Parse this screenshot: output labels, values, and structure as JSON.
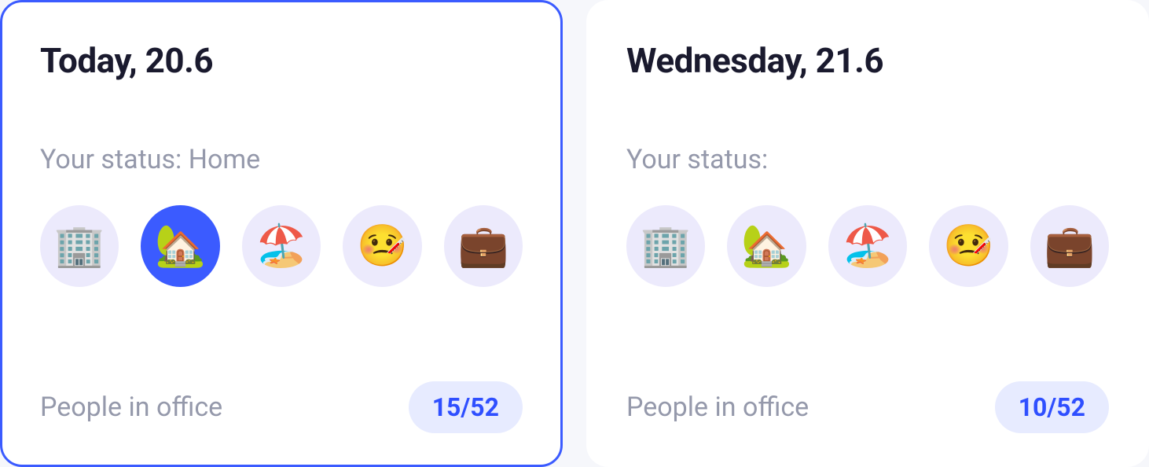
{
  "days": [
    {
      "title": "Today, 20.6",
      "selected": true,
      "status_prefix": "Your status: ",
      "status_value": "Home",
      "people_label": "People in office",
      "people_count": "15/52",
      "buttons": [
        {
          "name": "office",
          "emoji": "🏢",
          "active": false
        },
        {
          "name": "home",
          "emoji": "🏡",
          "active": true
        },
        {
          "name": "vacation",
          "emoji": "🏖️",
          "active": false
        },
        {
          "name": "sick",
          "emoji": "🤒",
          "active": false
        },
        {
          "name": "business-trip",
          "emoji": "💼",
          "active": false
        }
      ]
    },
    {
      "title": "Wednesday, 21.6",
      "selected": false,
      "status_prefix": "Your status:",
      "status_value": "",
      "people_label": "People in office",
      "people_count": "10/52",
      "buttons": [
        {
          "name": "office",
          "emoji": "🏢",
          "active": false
        },
        {
          "name": "home",
          "emoji": "🏡",
          "active": false
        },
        {
          "name": "vacation",
          "emoji": "🏖️",
          "active": false
        },
        {
          "name": "sick",
          "emoji": "🤒",
          "active": false
        },
        {
          "name": "business-trip",
          "emoji": "💼",
          "active": false
        }
      ]
    }
  ]
}
